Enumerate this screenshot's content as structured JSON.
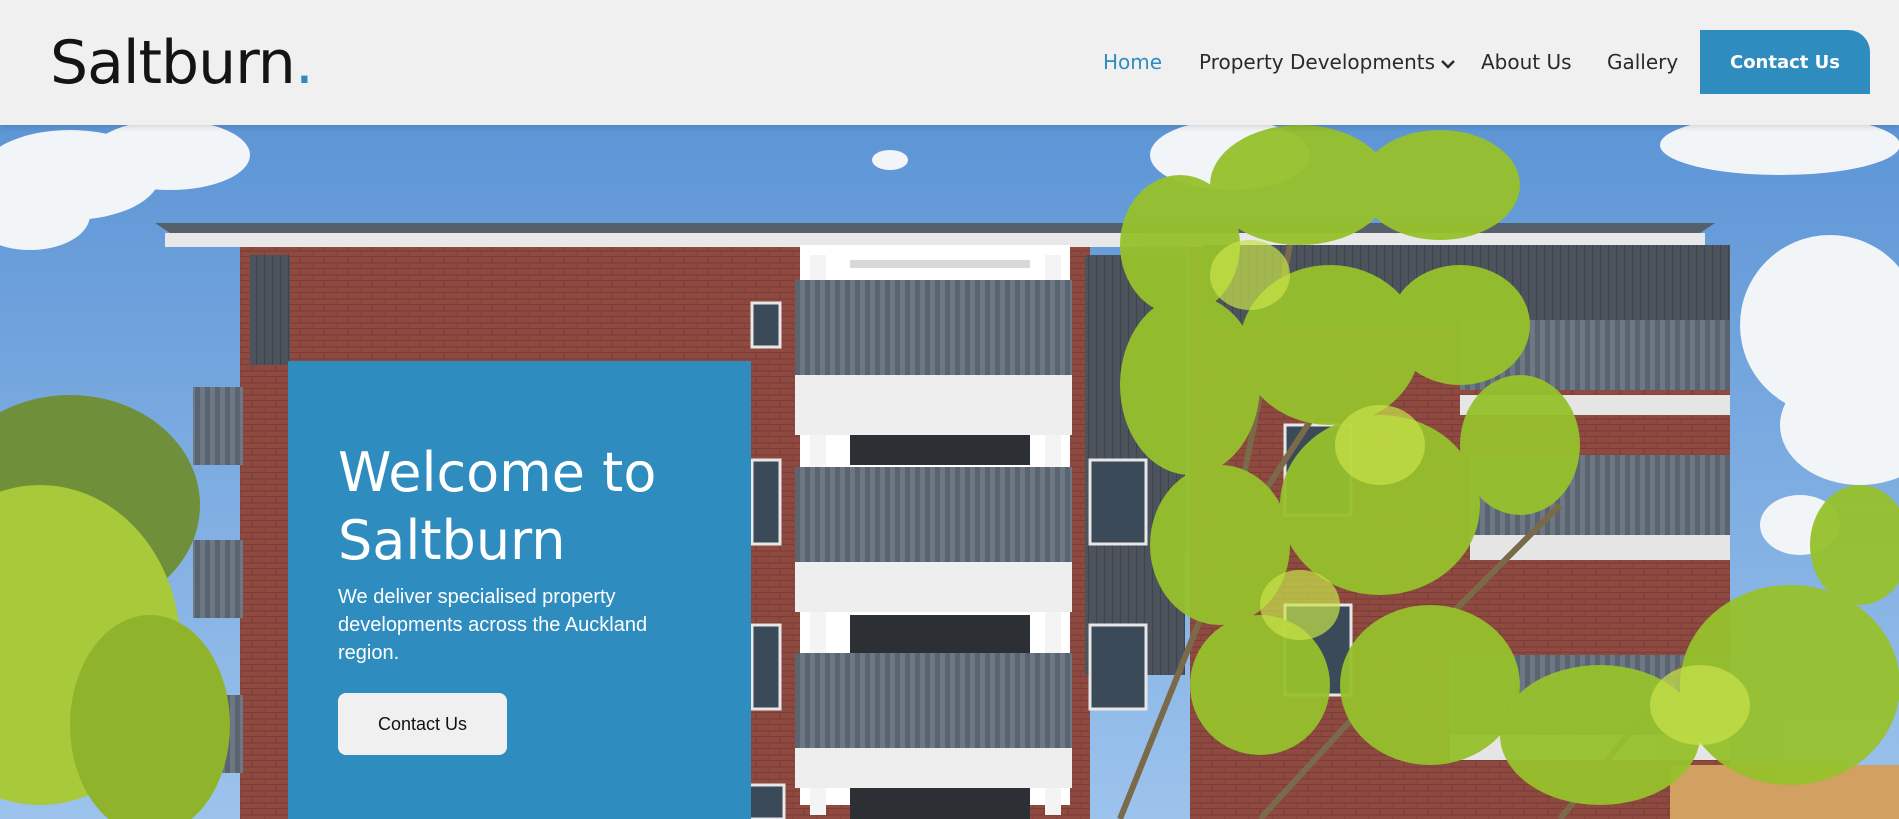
{
  "brand": {
    "name": "Saltburn",
    "dot": ".",
    "accent": "#2f8cbf"
  },
  "nav": {
    "home": "Home",
    "developments": "Property Developments",
    "about": "About Us",
    "gallery": "Gallery",
    "contact": "Contact Us"
  },
  "hero": {
    "title": "Welcome to Saltburn",
    "subtitle": "We deliver specialised property developments across the Auckland region.",
    "button": "Contact Us",
    "image_icon": "apartment-building-photo"
  },
  "colors": {
    "card": "#2f8cbf",
    "header_bg": "#f0f0f0",
    "active_link": "#2f8cbf"
  }
}
